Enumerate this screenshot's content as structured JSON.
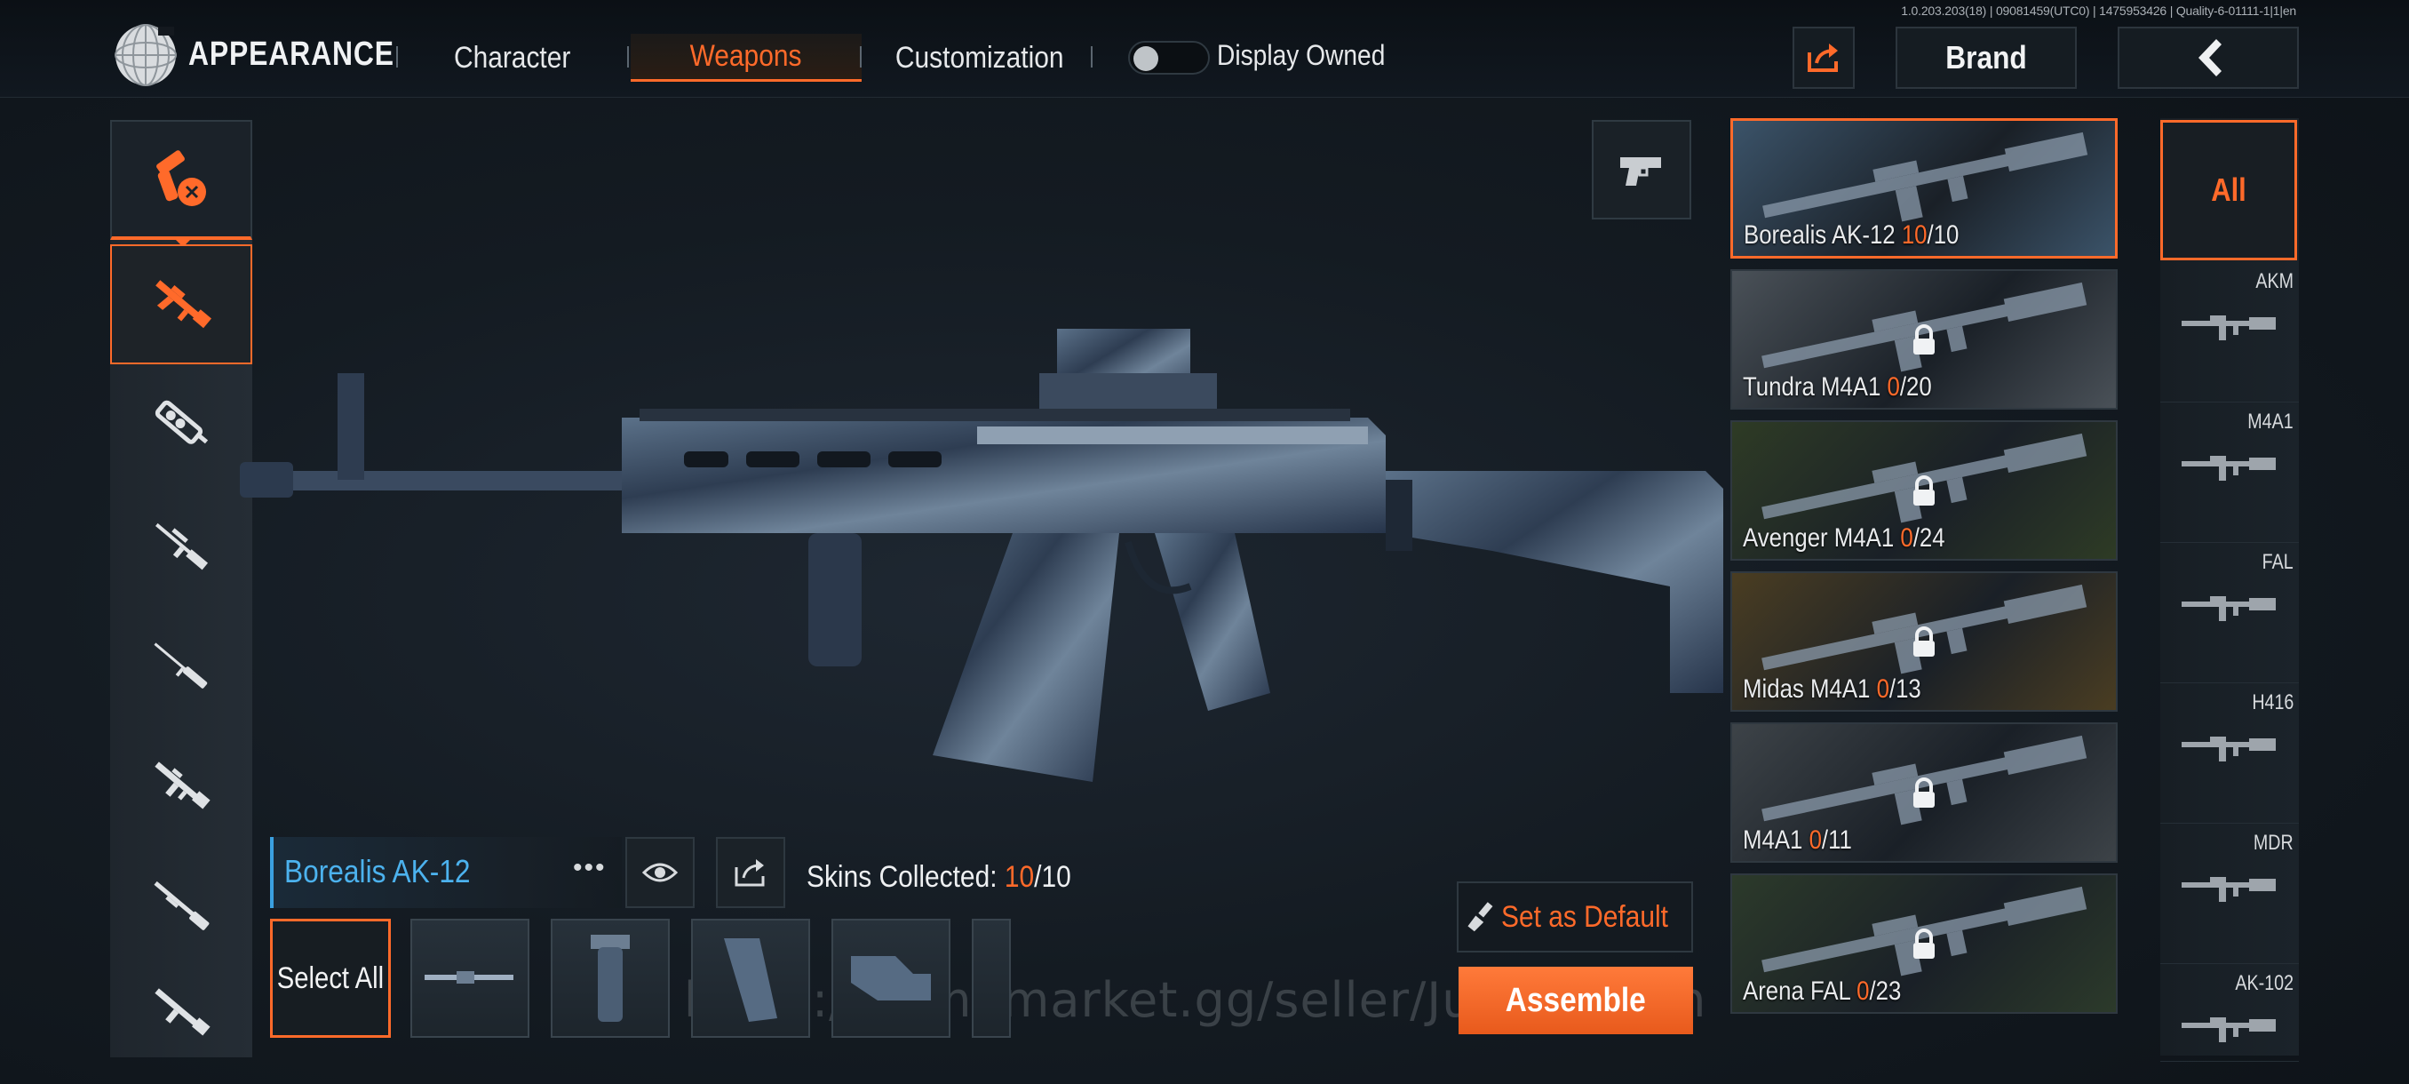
{
  "version": "1.0.203.203(18) | 09081459(UTC0) | 1475953426 | Quality-6-01111-1|1|en",
  "header": {
    "title": "APPEARANCE",
    "tabs": [
      {
        "label": "Character",
        "active": false
      },
      {
        "label": "Weapons",
        "active": true
      },
      {
        "label": "Customization",
        "active": false
      }
    ],
    "toggle_label": "Display Owned",
    "toggle_on": false,
    "brand_label": "Brand",
    "accent_color": "#ff6a2a"
  },
  "rail": {
    "icons": [
      "grenade-molotov-icon",
      "assault-rifle-icon",
      "smg-icon",
      "sniper-icon",
      "marksman-rifle-icon",
      "rifle-icon",
      "shotgun-icon",
      "lmg-icon"
    ]
  },
  "skin": {
    "name": "Borealis AK-12",
    "collected_label": "Skins Collected: ",
    "collected": "10",
    "total": "/10",
    "select_all": "Select All",
    "set_default": "Set as Default",
    "assemble": "Assemble"
  },
  "watermark": "https://gamemarket.gg/seller/Juragankun",
  "skins": [
    {
      "name": "Borealis AK-12 ",
      "owned": "10",
      "total": "/10",
      "locked": false,
      "selected": true,
      "bg": "#3b5369"
    },
    {
      "name": "Tundra M4A1 ",
      "owned": "0",
      "total": "/20",
      "locked": true,
      "selected": false,
      "bg": "#4a5158"
    },
    {
      "name": "Avenger M4A1 ",
      "owned": "0",
      "total": "/24",
      "locked": true,
      "selected": false,
      "bg": "#2e3b25"
    },
    {
      "name": "Midas M4A1 ",
      "owned": "0",
      "total": "/13",
      "locked": true,
      "selected": false,
      "bg": "#4a3d22"
    },
    {
      "name": "M4A1 ",
      "owned": "0",
      "total": "/11",
      "locked": true,
      "selected": false,
      "bg": "#3d4348"
    },
    {
      "name": "Arena FAL ",
      "owned": "0",
      "total": "/23",
      "locked": true,
      "selected": false,
      "bg": "#2c3a2a"
    }
  ],
  "weapon_types": {
    "all_label": "All",
    "items": [
      "AKM",
      "M4A1",
      "FAL",
      "H416",
      "MDR",
      "AK-102"
    ]
  }
}
